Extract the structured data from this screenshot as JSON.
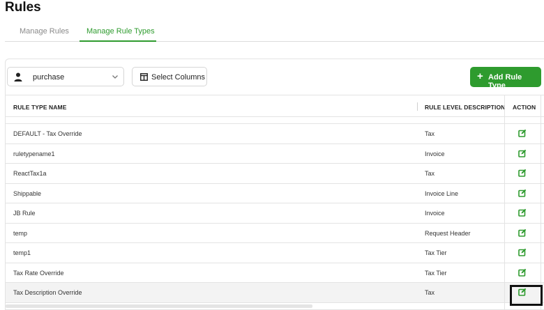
{
  "page": {
    "title": "Rules"
  },
  "tabs": [
    {
      "label": "Manage Rules",
      "active": false
    },
    {
      "label": "Manage Rule Types",
      "active": true
    }
  ],
  "toolbar": {
    "filter_value": "purchase",
    "select_columns_label": "Select Columns",
    "add_button_label": "Add Rule Type",
    "add_button_icon": "+"
  },
  "table": {
    "columns": [
      "RULE TYPE NAME",
      "RULE LEVEL DESCRIPTION",
      "ACTION"
    ],
    "rows": [
      {
        "name": "DEFAULT - Tax Override",
        "description": "Tax"
      },
      {
        "name": "ruletypename1",
        "description": "Invoice"
      },
      {
        "name": "ReactTax1a",
        "description": "Tax"
      },
      {
        "name": "Shippable",
        "description": "Invoice Line"
      },
      {
        "name": "JB Rule",
        "description": "Invoice"
      },
      {
        "name": "temp",
        "description": "Request Header"
      },
      {
        "name": "temp1",
        "description": "Tax Tier"
      },
      {
        "name": "Tax Rate Override",
        "description": "Tax Tier"
      },
      {
        "name": "Tax Description Override",
        "description": "Tax"
      }
    ]
  },
  "colors": {
    "accent": "#2e9b2e",
    "border": "#e3e3e3"
  },
  "icons": {
    "filter": "user-icon",
    "select_columns": "columns-icon",
    "row_action": "edit-icon",
    "dropdown": "chevron-down-icon"
  }
}
